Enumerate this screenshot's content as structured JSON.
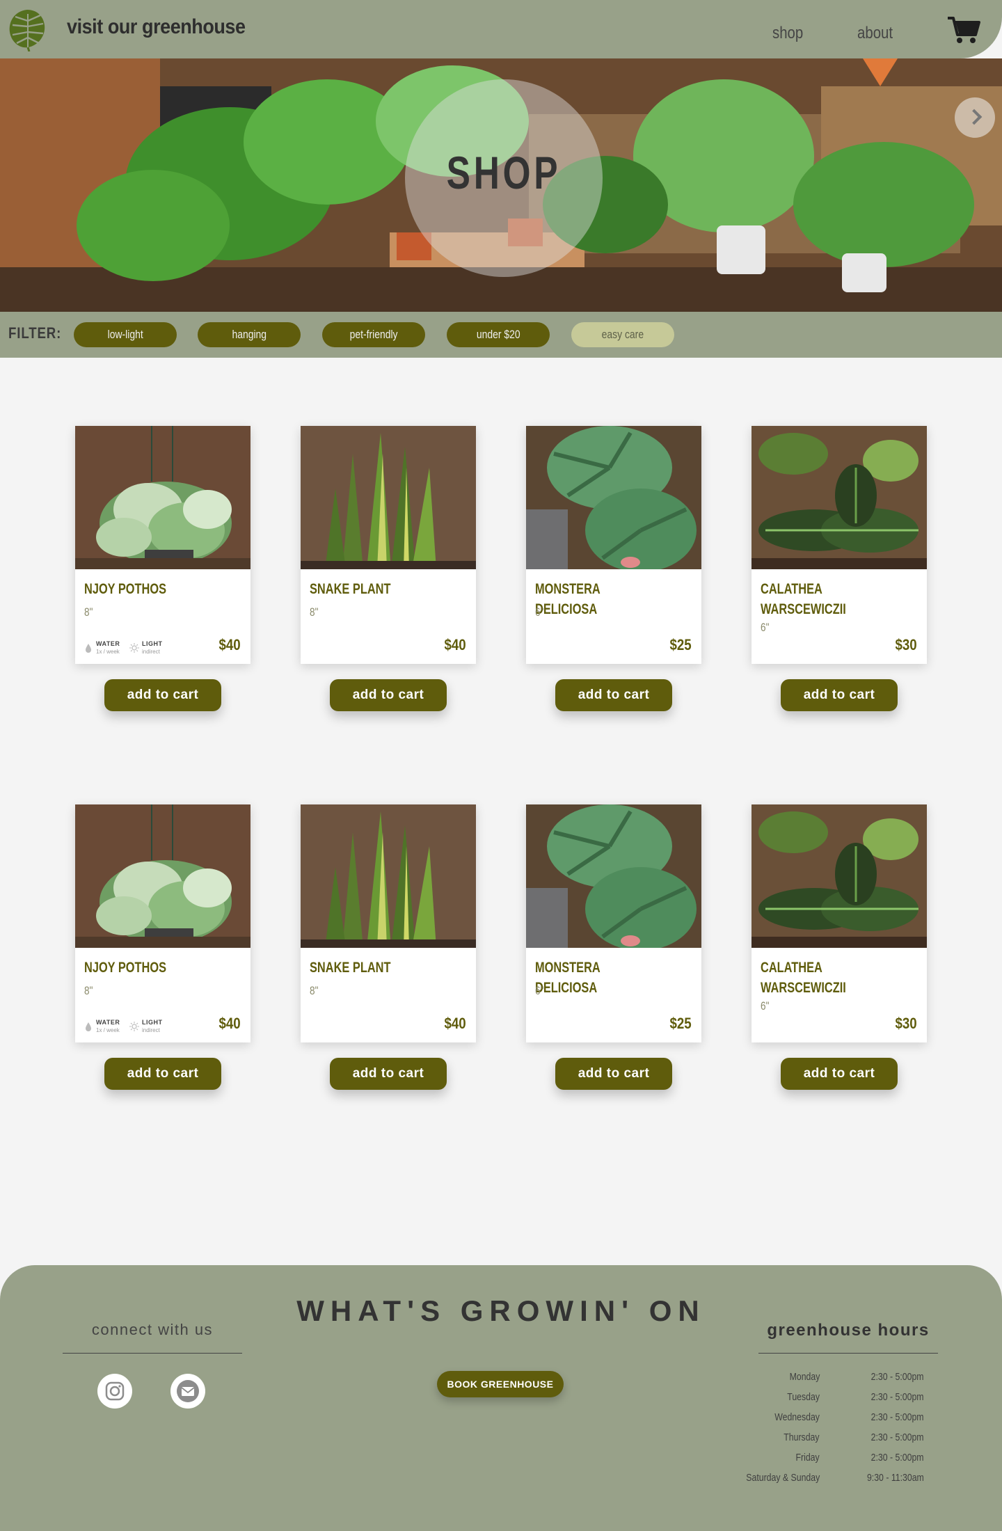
{
  "header": {
    "title": "visit our greenhouse",
    "nav": {
      "shop": "shop",
      "about": "about"
    },
    "logo_icon": "monstera-leaf-icon",
    "cart_icon": "cart-icon"
  },
  "hero": {
    "title": "SHOP",
    "next_icon": "chevron-right-icon"
  },
  "filter": {
    "label": "FILTER:",
    "options": [
      {
        "label": "low-light",
        "active": false
      },
      {
        "label": "hanging",
        "active": false
      },
      {
        "label": "pet-friendly",
        "active": false
      },
      {
        "label": "under $20",
        "active": false
      },
      {
        "label": "easy care",
        "active": true
      }
    ]
  },
  "products": [
    {
      "name": "NJOY POTHOS",
      "size": "8\"",
      "price": "$40",
      "water_label": "WATER",
      "water_value": "1x / week",
      "light_label": "LIGHT",
      "light_value": "indirect",
      "image": "pothos"
    },
    {
      "name": "SNAKE PLANT",
      "size": "8\"",
      "price": "$40",
      "image": "snake"
    },
    {
      "name": "MONSTERA DELICIOSA",
      "size": "6\"",
      "price": "$25",
      "image": "monstera"
    },
    {
      "name": "CALATHEA WARSCEWICZII",
      "size": "6\"",
      "price": "$30",
      "image": "calathea"
    },
    {
      "name": "NJOY POTHOS",
      "size": "8\"",
      "price": "$40",
      "water_label": "WATER",
      "water_value": "1x / week",
      "light_label": "LIGHT",
      "light_value": "indirect",
      "image": "pothos"
    },
    {
      "name": "SNAKE PLANT",
      "size": "8\"",
      "price": "$40",
      "image": "snake"
    },
    {
      "name": "MONSTERA DELICIOSA",
      "size": "6\"",
      "price": "$25",
      "image": "monstera"
    },
    {
      "name": "CALATHEA WARSCEWICZII",
      "size": "6\"",
      "price": "$30",
      "image": "calathea"
    }
  ],
  "add_to_cart_label": "add to cart",
  "footer": {
    "connect_title": "connect with us",
    "social": [
      "instagram-icon",
      "email-icon"
    ],
    "headline": "WHAT'S GROWIN' ON",
    "book_label": "BOOK GREENHOUSE",
    "hours_title": "greenhouse hours",
    "hours": [
      {
        "day": "Monday",
        "time": "2:30 - 5:00pm"
      },
      {
        "day": "Tuesday",
        "time": "2:30 - 5:00pm"
      },
      {
        "day": "Wednesday",
        "time": "2:30 - 5:00pm"
      },
      {
        "day": "Thursday",
        "time": "2:30 - 5:00pm"
      },
      {
        "day": "Friday",
        "time": "2:30 - 5:00pm"
      },
      {
        "day": "Saturday & Sunday",
        "time": "9:30 - 11:30am"
      }
    ]
  },
  "colors": {
    "sage": "#98a189",
    "olive": "#5f5c0c",
    "chip_active": "#c6c998",
    "background": "#f4f4f4"
  }
}
